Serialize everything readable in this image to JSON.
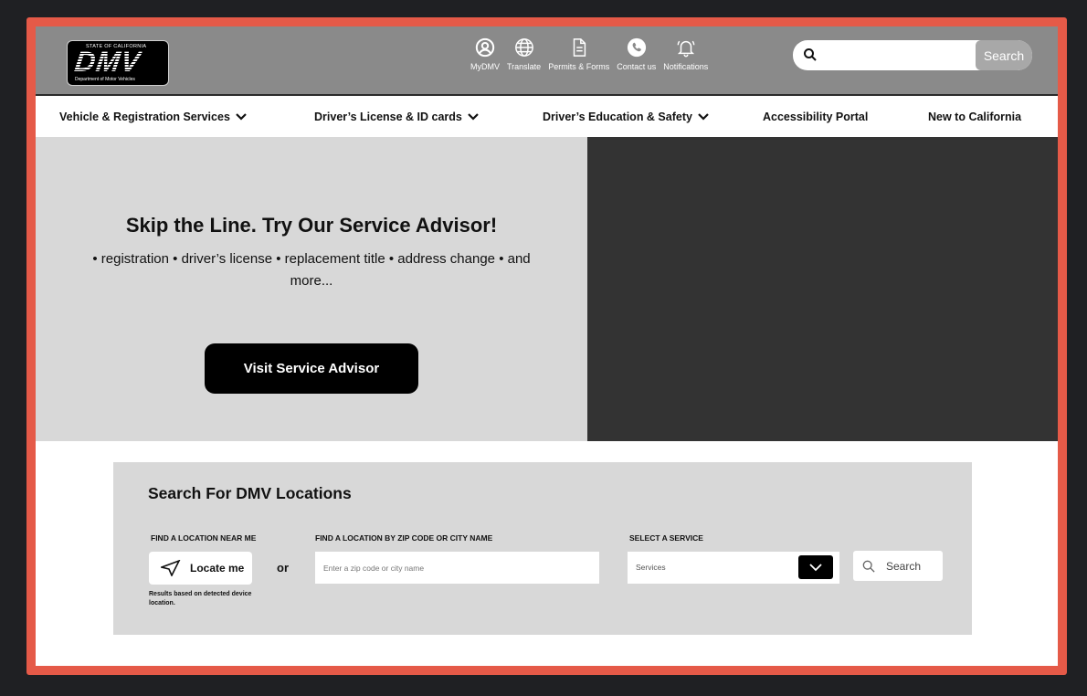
{
  "header": {
    "logo": {
      "state_text": "STATE OF CALIFORNIA",
      "letters": "DMV",
      "dept_text": "Department of Motor Vehicles"
    },
    "nav_icons": [
      {
        "icon": "user-circle-icon",
        "label": "MyDMV"
      },
      {
        "icon": "globe-icon",
        "label": "Translate"
      },
      {
        "icon": "document-icon",
        "label": "Permits & Forms"
      },
      {
        "icon": "phone-icon",
        "label": "Contact us"
      },
      {
        "icon": "bell-icon",
        "label": "Notifications"
      }
    ],
    "search": {
      "placeholder": "",
      "button_label": "Search"
    }
  },
  "main_nav": [
    {
      "label": "Vehicle & Registration Services",
      "has_dropdown": true
    },
    {
      "label": "Driver’s License & ID cards",
      "has_dropdown": true
    },
    {
      "label": "Driver’s Education & Safety",
      "has_dropdown": true
    },
    {
      "label": "Accessibility Portal",
      "has_dropdown": false
    },
    {
      "label": "New to California",
      "has_dropdown": false
    }
  ],
  "hero": {
    "title": "Skip the Line. Try Our Service Advisor!",
    "subtitle": "• registration • driver’s license • replacement title • address change • and more...",
    "button_label": "Visit Service Advisor"
  },
  "locations": {
    "title": "Search For DMV Locations",
    "near_me_label": "FIND A LOCATION NEAR ME",
    "locate_button": "Locate me",
    "or_text": "or",
    "note": "Results based on detected device location.",
    "zip_label": "FIND A LOCATION BY ZIP CODE OR CITY NAME",
    "zip_placeholder": "Enter a zip code or city name",
    "service_label": "SELECT A SERVICE",
    "service_value": "Services",
    "search_button": "Search"
  },
  "colors": {
    "frame": "#e55a48",
    "header_bg": "#8a8a8a",
    "hero_left_bg": "#d8d8d8",
    "hero_right_bg": "#333333",
    "panel_bg": "#d8d8d8"
  }
}
